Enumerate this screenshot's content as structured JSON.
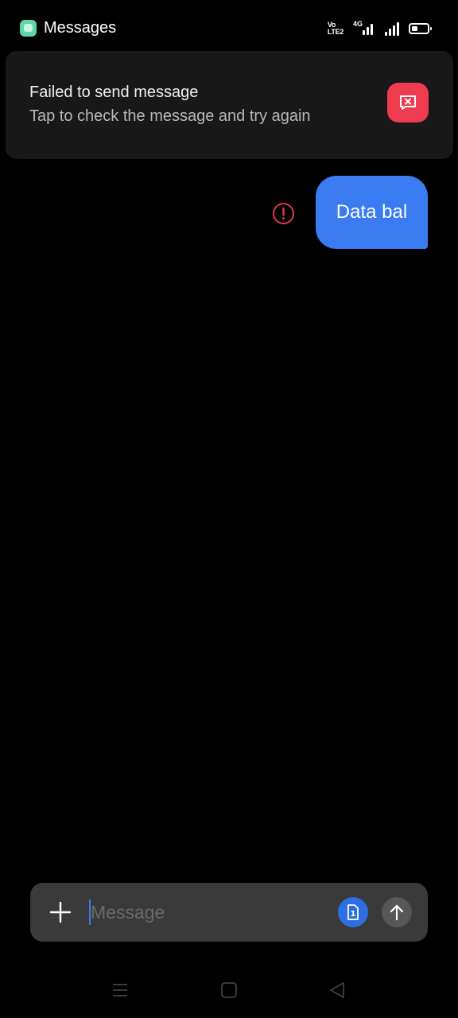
{
  "status_bar": {
    "app_name": "Messages",
    "network_label": "4G",
    "volte_top": "Vo",
    "volte_bottom": "LTE",
    "volte_sub": "2",
    "icons": [
      "messages-app-icon",
      "volte-icon",
      "network-4g-icon",
      "signal-icon",
      "battery-icon"
    ]
  },
  "banner": {
    "title": "Failed to send message",
    "subtitle": "Tap to check the message and try again",
    "action_icon": "close-message-icon",
    "action_color": "#ee3b4f"
  },
  "conversation": {
    "messages": [
      {
        "text": "Data bal",
        "direction": "outgoing",
        "status": "failed",
        "status_icon": "error-icon"
      }
    ],
    "bubble_color": "#3a7bf2",
    "error_color": "#e03a4a"
  },
  "composer": {
    "placeholder": "Message",
    "value": "",
    "add_icon": "plus-icon",
    "sim_label": "1",
    "sim_icon": "sim-icon",
    "send_icon": "send-arrow-icon"
  },
  "navbar": {
    "icons": [
      "menu-icon",
      "home-icon",
      "back-icon"
    ]
  }
}
